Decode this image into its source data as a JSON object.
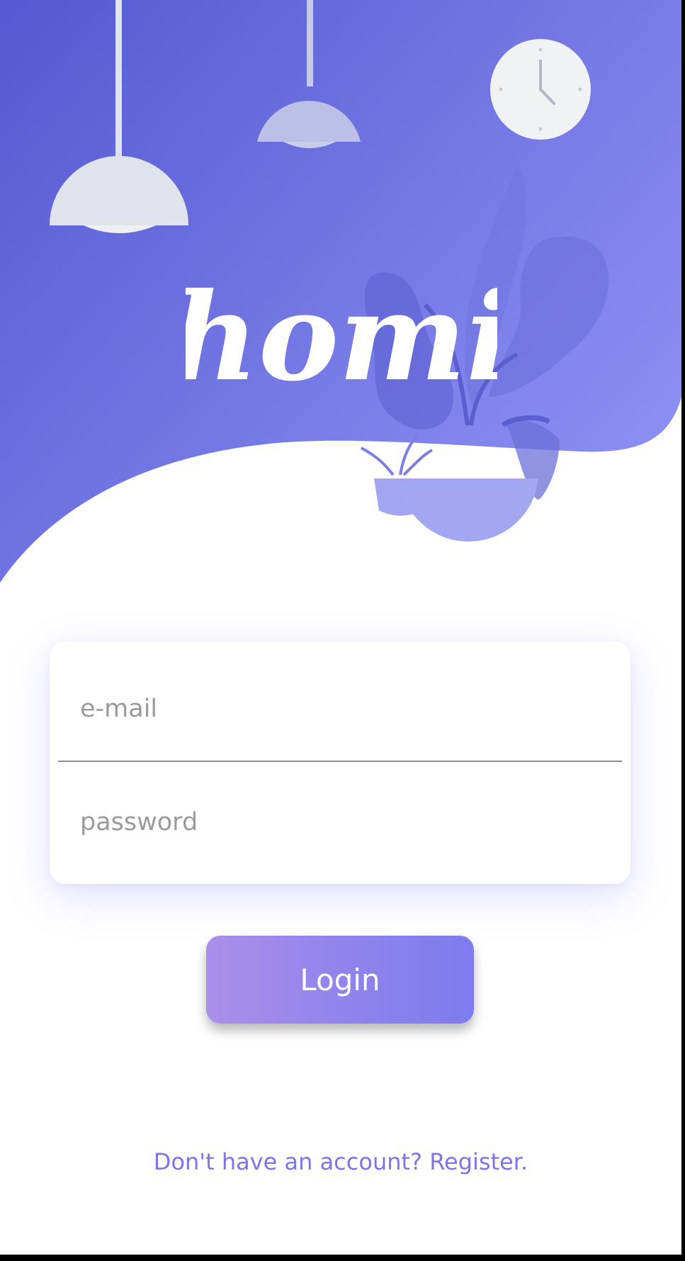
{
  "app": {
    "logo_text": "homi"
  },
  "login_form": {
    "email_placeholder": "e-mail",
    "password_placeholder": "password",
    "login_label": "Login"
  },
  "footer": {
    "register_text": "Don't have an account? Register."
  },
  "icons": [
    "ceiling-lamp-icon",
    "wall-clock-icon",
    "potted-plant-icon"
  ],
  "colors": {
    "header_gradient_start": "#5459d1",
    "header_gradient_end": "#8c90f3",
    "button_gradient_start": "#a98fe8",
    "button_gradient_end": "#7d7bee",
    "link": "#7d74e6"
  }
}
